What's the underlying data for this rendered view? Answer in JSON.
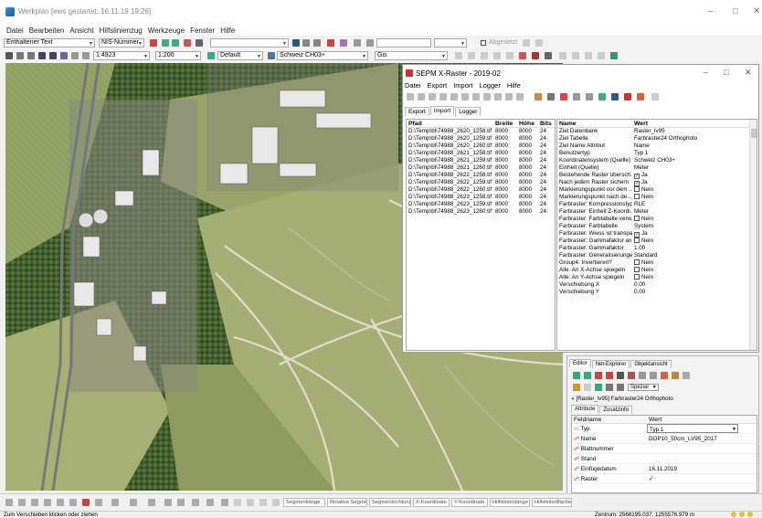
{
  "window": {
    "title": "Werkplan [ews gestartet: 16.11.19 19:26]"
  },
  "menu": [
    "Datei",
    "Bearbeiten",
    "Ansicht",
    "Hilfslinienzug",
    "Werkzeuge",
    "Fenster",
    "Hilfe"
  ],
  "toolbar1": {
    "text_combo": "Enthaltener Text",
    "nis_combo": "NIS-Nummer",
    "abgesetzt": "Abgesetzt"
  },
  "toolbar2": {
    "scale_value": "1:4923",
    "scale_combo": "1:200",
    "default_combo": "Default",
    "crs_combo": "Schweiz CH03+",
    "gis_combo": "Gis"
  },
  "dialog": {
    "title": "SEPM X-Raster - 2019-02",
    "menu": [
      "Datei",
      "Export",
      "Import",
      "Logger",
      "Hilfe"
    ],
    "tabs": [
      "Export",
      "Import",
      "Logger"
    ],
    "files": {
      "headers": [
        "Pfad",
        "Breite",
        "Höhe",
        "Bits"
      ],
      "rows": [
        [
          "D:\\Temp\\bl\\74988_2620_1258.tif",
          "8000",
          "8000",
          "24"
        ],
        [
          "D:\\Temp\\bl\\74988_2620_1259.tif",
          "8000",
          "8000",
          "24"
        ],
        [
          "D:\\Temp\\bl\\74988_2620_1260.tif",
          "8000",
          "8000",
          "24"
        ],
        [
          "D:\\Temp\\bl\\74988_2621_1258.tif",
          "8000",
          "8000",
          "24"
        ],
        [
          "D:\\Temp\\bl\\74988_2621_1259.tif",
          "8000",
          "8000",
          "24"
        ],
        [
          "D:\\Temp\\bl\\74988_2621_1260.tif",
          "8000",
          "8000",
          "24"
        ],
        [
          "D:\\Temp\\bl\\74988_2622_1258.tif",
          "8000",
          "8000",
          "24"
        ],
        [
          "D:\\Temp\\bl\\74988_2622_1259.tif",
          "8000",
          "8000",
          "24"
        ],
        [
          "D:\\Temp\\bl\\74988_2622_1260.tif",
          "8000",
          "8000",
          "24"
        ],
        [
          "D:\\Temp\\bl\\74988_2623_1258.tif",
          "8000",
          "8000",
          "24"
        ],
        [
          "D:\\Temp\\bl\\74988_2623_1259.tif",
          "8000",
          "8000",
          "24"
        ],
        [
          "D:\\Temp\\bl\\74988_2623_1260.tif",
          "8000",
          "8000",
          "24"
        ]
      ]
    },
    "props": {
      "headers": [
        "Name",
        "Wert"
      ],
      "rows": [
        {
          "name": "Ziel Datenbank",
          "value": "Raster_lv95",
          "check": ""
        },
        {
          "name": "Ziel Tabelle",
          "value": "Farbraster24 Orthophoto",
          "check": ""
        },
        {
          "name": "Ziel Name Attribut",
          "value": "Name",
          "check": ""
        },
        {
          "name": "Benutzertyp",
          "value": "Typ 1",
          "check": ""
        },
        {
          "name": "Koordinatensystem (Quelle)",
          "value": "Schweiz CH03+",
          "check": ""
        },
        {
          "name": "Einheit (Quelle)",
          "value": "Meter",
          "check": ""
        },
        {
          "name": "Bestehende Raster übersch...",
          "value": "Ja",
          "check": "on"
        },
        {
          "name": "Nach jedem Raster sichern",
          "value": "Ja",
          "check": "on"
        },
        {
          "name": "Markierungspunkt vor dem ...",
          "value": "Nein",
          "check": "off"
        },
        {
          "name": "Markierungspunkt nach de...",
          "value": "Nein",
          "check": "off"
        },
        {
          "name": "Farbraster: Kompressionstyp",
          "value": "RLE",
          "check": ""
        },
        {
          "name": "Farbraster: Einheit Z-Koordi...",
          "value": "Meter",
          "check": ""
        },
        {
          "name": "Farbraster: Farbtabelle verw...",
          "value": "Nein",
          "check": "off"
        },
        {
          "name": "Farbraster: Farbtabelle",
          "value": "System",
          "check": ""
        },
        {
          "name": "Farbraster: Weiss ist transpa...",
          "value": "Ja",
          "check": "on"
        },
        {
          "name": "Farbraster: Gammafaktor an...",
          "value": "Nein",
          "check": "off"
        },
        {
          "name": "Farbraster: Gammafaktor",
          "value": "1.00",
          "check": ""
        },
        {
          "name": "Farbraster: Generalisierungen",
          "value": "Standard",
          "check": ""
        },
        {
          "name": "Group4: Invertieren?",
          "value": "Nein",
          "check": "off"
        },
        {
          "name": "Alle: An X-Achse spiegeln",
          "value": "Nein",
          "check": "off"
        },
        {
          "name": "Alle: An Y-Achse spiegeln",
          "value": "Nein",
          "check": "off"
        },
        {
          "name": "Verschiebung X",
          "value": "0.00",
          "check": ""
        },
        {
          "name": "Verschiebung Y",
          "value": "0.00",
          "check": ""
        }
      ]
    }
  },
  "editor": {
    "tabs": [
      "Editor",
      "Net-Explorer",
      "Objektansicht"
    ],
    "spezial": "Spezial",
    "object_label": "[Raster_lv95] Farbraster24 Orthophoto",
    "subtabs": [
      "Attribute",
      "Zusatzinfo"
    ],
    "headers": [
      "Feldname",
      "Wert"
    ],
    "rows": [
      {
        "field": "Typ",
        "value": "Typ 1"
      },
      {
        "field": "Name",
        "value": "DOP10_50cm_LV95_2017"
      },
      {
        "field": "Blattnummer",
        "value": ""
      },
      {
        "field": "Stand",
        "value": ""
      },
      {
        "field": "Einfügedatum",
        "value": "16.11.2019"
      },
      {
        "field": "Raster",
        "value": "✓"
      }
    ]
  },
  "segment_buttons": [
    "Segmentlänge",
    "Relative Segme",
    "Segmentrichtung",
    "X-Koordinate",
    "Y-Koordinate",
    "Hilfslinienlänge",
    "Hilfslinienfläche"
  ],
  "status": {
    "left": "Zum Verschieben klicken oder ziehen",
    "center": "Zentrum: 2568195.037, 1255576.979 m"
  },
  "colors": {
    "accent": "#1a5fa0",
    "dialog_icon": "#d0312d",
    "map_base": "#6f7d50"
  }
}
